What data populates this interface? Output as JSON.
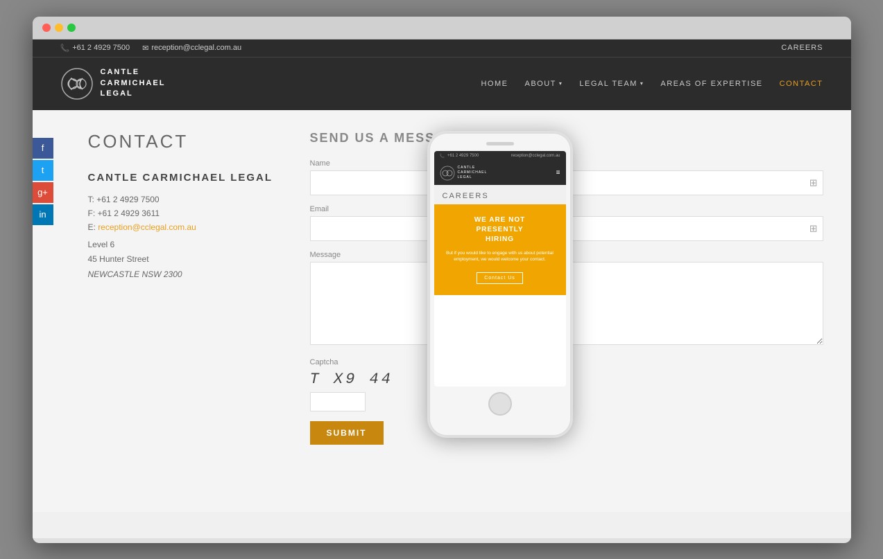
{
  "browser": {
    "dots": [
      "red",
      "yellow",
      "green"
    ]
  },
  "topbar": {
    "phone": "+61 2 4929 7500",
    "email": "reception@cclegal.com.au",
    "careers": "CAREERS"
  },
  "header": {
    "logo_line1": "CANTLE",
    "logo_line2": "CARMICHAEL",
    "logo_line3": "LEGAL",
    "nav": [
      {
        "label": "HOME",
        "has_arrow": false,
        "active": false
      },
      {
        "label": "ABOUT",
        "has_arrow": true,
        "active": false
      },
      {
        "label": "LEGAL TEAM",
        "has_arrow": true,
        "active": false
      },
      {
        "label": "AREAS OF EXPERTISE",
        "has_arrow": false,
        "active": false
      },
      {
        "label": "CONTACT",
        "has_arrow": false,
        "active": true
      }
    ]
  },
  "social": [
    {
      "icon": "f",
      "class": "social-fb",
      "label": "facebook"
    },
    {
      "icon": "t",
      "class": "social-tw",
      "label": "twitter"
    },
    {
      "icon": "g+",
      "class": "social-gp",
      "label": "google-plus"
    },
    {
      "icon": "in",
      "class": "social-li",
      "label": "linkedin"
    }
  ],
  "contact_page": {
    "heading": "CONTACT",
    "firm_name": "CANTLE CARMICHAEL LEGAL",
    "phone_label": "T:",
    "phone": "+61 2 4929 7500",
    "fax_label": "F:",
    "fax": "+61 2 4929 3611",
    "email_label": "E:",
    "email": "reception@cclegal.com.au",
    "address_line1": "Level 6",
    "address_line2": "45 Hunter Street",
    "address_line3": "NEWCASTLE NSW 2300"
  },
  "form": {
    "send_heading": "SEND US A MESSAGE:",
    "name_label": "Name",
    "email_label": "Email",
    "message_label": "Message",
    "captcha_label": "Captcha",
    "captcha_text": "T X9 44",
    "submit_label": "SUBMIT"
  },
  "phone_overlay": {
    "topbar_phone": "+61 2 4929 7500",
    "topbar_email": "reception@cclegal.com.au",
    "logo_line1": "CANTLE",
    "logo_line2": "CARMICHAEL",
    "logo_line3": "LEGAL",
    "careers_title": "CAREERS",
    "card_title_line1": "WE ARE NOT",
    "card_title_line2": "PRESENTLY",
    "card_title_line3": "HIRING",
    "card_body": "But if you would like to engage with us about potential employment, we would welcome your contact.",
    "contact_btn": "Contact Us"
  }
}
